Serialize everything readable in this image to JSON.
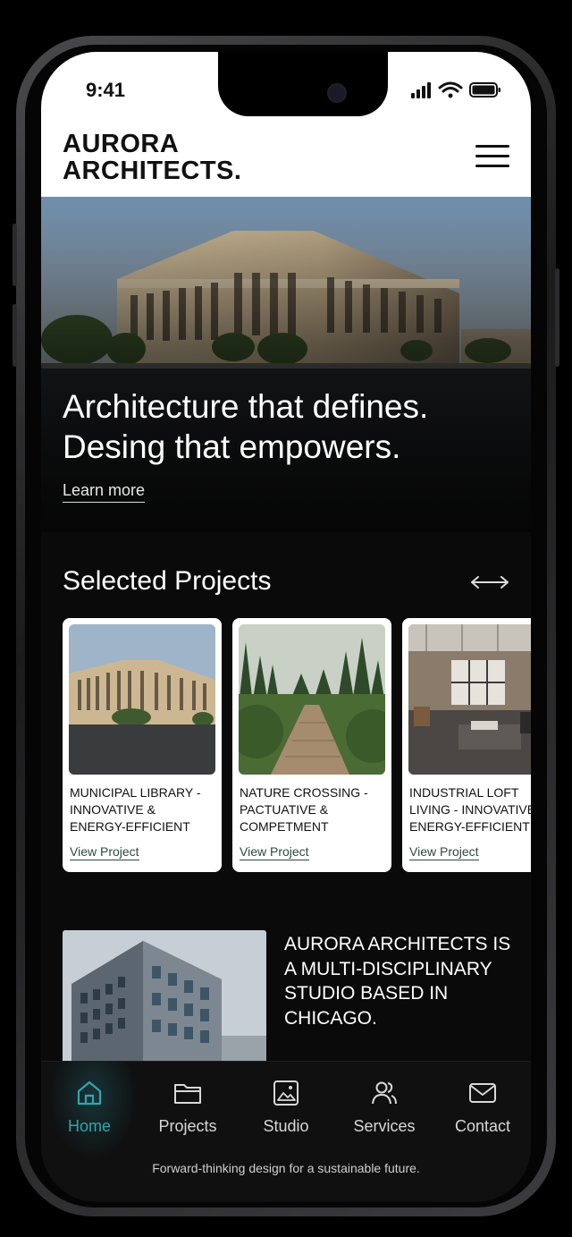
{
  "status": {
    "time": "9:41"
  },
  "header": {
    "brand_line1": "AURORA",
    "brand_line2": "ARCHITECTS.",
    "menu_icon": "hamburger-menu-icon"
  },
  "hero": {
    "title_line1": "Architecture that defines.",
    "title_line2": "Desing that empowers.",
    "link": "Learn more"
  },
  "projects": {
    "title": "Selected Projects",
    "scroll_icon": "double-arrow-icon",
    "items": [
      {
        "caption": "MUNICIPAL LIBRARY -\nINNOVATIVE &\nENERGY-EFFICIENT",
        "link": "View Project"
      },
      {
        "caption": "NATURE CROSSING -\nPACTUATIVE &\nCOMPETMENT",
        "link": "View Project"
      },
      {
        "caption": "INDUSTRIAL LOFT\nLIVING - INNOVATIVE\nENERGY-EFFICIENT",
        "link": "View Project"
      }
    ]
  },
  "about": {
    "text": "AURORA ARCHITECTS IS A MULTI-DISCIPLINARY STUDIO BASED IN CHICAGO."
  },
  "nav": {
    "items": [
      {
        "label": "Home",
        "icon": "home-icon"
      },
      {
        "label": "Projects",
        "icon": "folder-icon"
      },
      {
        "label": "Studio",
        "icon": "image-icon"
      },
      {
        "label": "Services",
        "icon": "people-icon"
      },
      {
        "label": "Contact",
        "icon": "mail-icon"
      }
    ],
    "active": "Home",
    "active_color": "#2fa6b0"
  },
  "footer": {
    "tagline": "Forward-thinking design for a sustainable future."
  }
}
